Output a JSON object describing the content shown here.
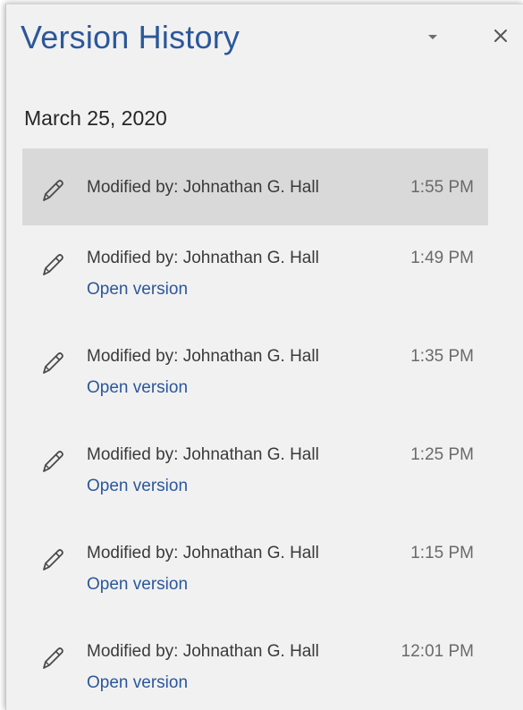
{
  "panel": {
    "title": "Version History",
    "dropdown_icon": "caret-down-icon",
    "close_icon": "close-icon"
  },
  "date_group": {
    "date": "March 25, 2020"
  },
  "entries": [
    {
      "modified": "Modified by: Johnathan G. Hall",
      "time": "1:55 PM",
      "selected": true,
      "open_label": ""
    },
    {
      "modified": "Modified by: Johnathan G. Hall",
      "time": "1:49 PM",
      "selected": false,
      "open_label": "Open version"
    },
    {
      "modified": "Modified by: Johnathan G. Hall",
      "time": "1:35 PM",
      "selected": false,
      "open_label": "Open version"
    },
    {
      "modified": "Modified by: Johnathan G. Hall",
      "time": "1:25 PM",
      "selected": false,
      "open_label": "Open version"
    },
    {
      "modified": "Modified by: Johnathan G. Hall",
      "time": "1:15 PM",
      "selected": false,
      "open_label": "Open version"
    },
    {
      "modified": "Modified by: Johnathan G. Hall",
      "time": "12:01 PM",
      "selected": false,
      "open_label": "Open version"
    }
  ],
  "colors": {
    "accent": "#2b579a",
    "panel_bg": "#f1f1f1",
    "selected_bg": "#d9d9d9",
    "text": "#3a3a3a"
  }
}
